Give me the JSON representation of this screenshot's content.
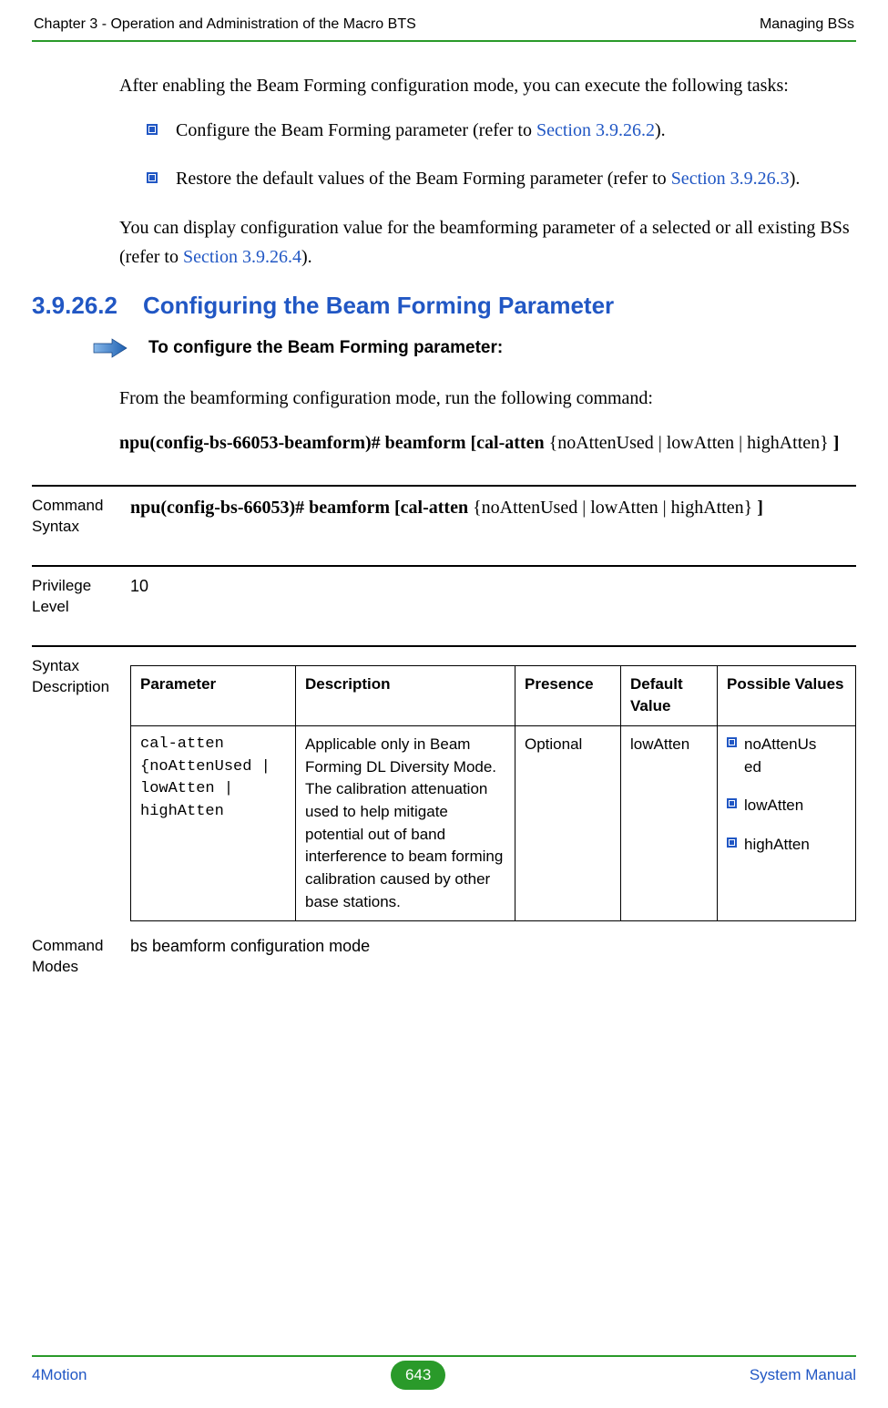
{
  "header": {
    "left": "Chapter 3 - Operation and Administration of the Macro BTS",
    "right": "Managing BSs"
  },
  "intro": {
    "para1": "After enabling the Beam Forming configuration mode, you can execute the following tasks:",
    "bullet1_pre": "Configure the Beam Forming parameter (refer to ",
    "bullet1_link": "Section 3.9.26.2",
    "bullet1_post": ").",
    "bullet2_pre": "Restore the default values of the Beam Forming parameter (refer to ",
    "bullet2_link": "Section 3.9.26.3",
    "bullet2_post": ").",
    "para2_pre": "You can display configuration value for the beamforming parameter of a selected or all existing BSs (refer to ",
    "para2_link": "Section 3.9.26.4",
    "para2_post": ")."
  },
  "section": {
    "num": "3.9.26.2",
    "title": "Configuring the Beam Forming Parameter"
  },
  "procedure": {
    "label": "To configure the Beam Forming parameter:",
    "line": "From the beamforming configuration mode, run the following command:",
    "cmd_bold1": "npu(config-bs-66053-beamform)# beamform [cal-atten ",
    "cmd_mid": "{noAtten Used | lowAtten | highAtten}",
    "cmd_mid_real": "{noAttenUsed | lowAtten | highAtten}",
    "cmd_bold2": " ]"
  },
  "defs": {
    "syntax_label": "Command Syntax",
    "syntax_bold": "npu(config-bs-66053)# beamform [cal-atten ",
    "syntax_mid": "{noAttenUsed | lowAtten | highAtten}",
    "syntax_bold2": " ]",
    "priv_label": "Privilege Level",
    "priv_value": "10",
    "desc_label": "Syntax Description",
    "modes_label": "Command Modes",
    "modes_value": "bs beamform configuration mode"
  },
  "table": {
    "headers": {
      "c1": "Parameter",
      "c2": "Description",
      "c3": "Presence",
      "c4": "Default Value",
      "c5": "Possible Values"
    },
    "row": {
      "param": "cal-atten {noAttenUsed | lowAtten | highAtten",
      "desc": "Applicable only in Beam Forming DL Diversity Mode. The calibration attenuation used to help mitigate potential out of band interference to beam forming calibration caused by other base stations.",
      "presence": "Optional",
      "defv": "lowAtten",
      "pv1a": "noAttenUs",
      "pv1b": "ed",
      "pv2": "lowAtten",
      "pv3": "highAtten"
    }
  },
  "footer": {
    "left": "4Motion",
    "page": "643",
    "right": "System Manual"
  }
}
